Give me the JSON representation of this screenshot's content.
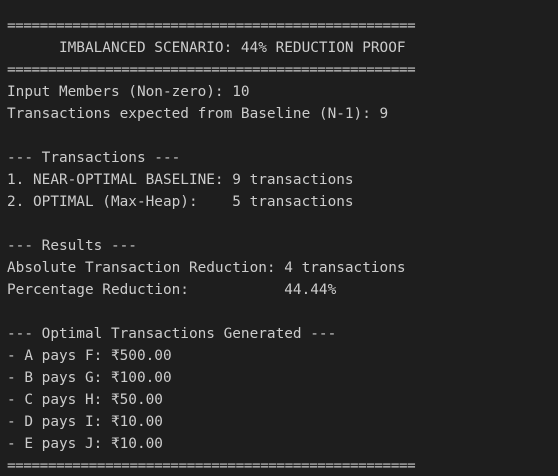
{
  "terminal": {
    "rule": "==================================================",
    "title_line": "      IMBALANCED SCENARIO: 44% REDUCTION PROOF",
    "input_members": "Input Members (Non-zero): 10",
    "expected_baseline": "Transactions expected from Baseline (N-1): 9",
    "transactions_header": "--- Transactions ---",
    "baseline_line": "1. NEAR-OPTIMAL BASELINE: 9 transactions",
    "optimal_line": "2. OPTIMAL (Max-Heap):    5 transactions",
    "results_header": "--- Results ---",
    "absolute_reduction": "Absolute Transaction Reduction: 4 transactions",
    "percentage_reduction": "Percentage Reduction:           44.44%",
    "optimal_header": "--- Optimal Transactions Generated ---",
    "payments": [
      "- A pays F: ₹500.00",
      "- B pays G: ₹100.00",
      "- C pays H: ₹50.00",
      "- D pays I: ₹10.00",
      "- E pays J: ₹10.00"
    ]
  }
}
